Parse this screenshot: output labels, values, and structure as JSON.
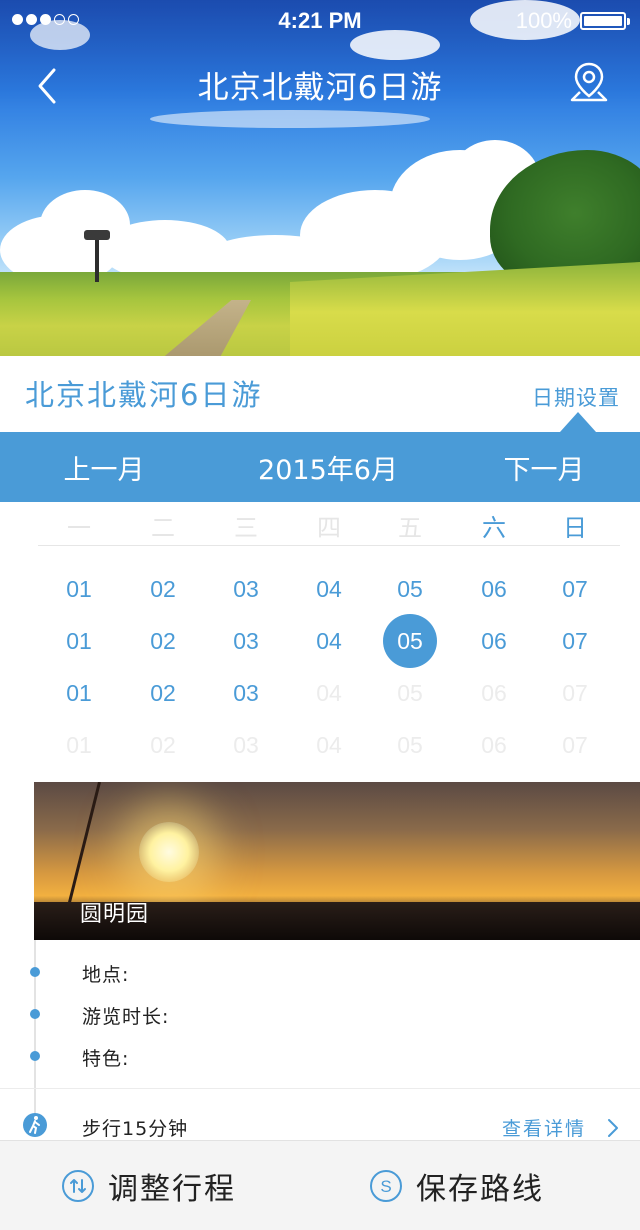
{
  "status_bar": {
    "time": "4:21 PM",
    "battery": "100%",
    "signal_dots_filled": 3,
    "signal_dots_total": 5
  },
  "nav": {
    "title": "北京北戴河6日游",
    "back_icon": "chevron-left-icon",
    "map_icon": "map-pin-icon"
  },
  "trip": {
    "title": "北京北戴河6日游",
    "date_setting": "日期设置"
  },
  "month_bar": {
    "prev": "上一月",
    "current": "2015年6月",
    "next": "下一月"
  },
  "calendar": {
    "weekdays": [
      "一",
      "二",
      "三",
      "四",
      "五",
      "六",
      "日"
    ],
    "weekend_indexes": [
      5,
      6
    ],
    "rows": [
      [
        {
          "d": "01"
        },
        {
          "d": "02"
        },
        {
          "d": "03"
        },
        {
          "d": "04"
        },
        {
          "d": "05"
        },
        {
          "d": "06"
        },
        {
          "d": "07"
        }
      ],
      [
        {
          "d": "01"
        },
        {
          "d": "02"
        },
        {
          "d": "03"
        },
        {
          "d": "04"
        },
        {
          "d": "05",
          "selected": true
        },
        {
          "d": "06"
        },
        {
          "d": "07"
        }
      ],
      [
        {
          "d": "01"
        },
        {
          "d": "02"
        },
        {
          "d": "03"
        },
        {
          "d": "04",
          "muted": true
        },
        {
          "d": "05",
          "muted": true
        },
        {
          "d": "06",
          "muted": true
        },
        {
          "d": "07",
          "muted": true
        }
      ],
      [
        {
          "d": "01",
          "muted": true
        },
        {
          "d": "02",
          "muted": true
        },
        {
          "d": "03",
          "muted": true
        },
        {
          "d": "04",
          "muted": true
        },
        {
          "d": "05",
          "muted": true
        },
        {
          "d": "06",
          "muted": true
        },
        {
          "d": "07",
          "muted": true
        }
      ]
    ]
  },
  "attraction": {
    "name": "圆明园",
    "location_label": "地点:",
    "duration_label": "游览时长:",
    "feature_label": "特色:"
  },
  "transit": {
    "text": "步行15分钟",
    "details": "查看详情",
    "icon": "walking-person-icon"
  },
  "bottom_bar": {
    "adjust_label": "调整行程",
    "save_label": "保存路线",
    "adjust_icon": "swap-arrows-icon",
    "save_icon": "dollar-s-icon"
  },
  "colors": {
    "accent": "#4a9bd7",
    "text": "#222222",
    "muted": "#e6e6e6"
  }
}
